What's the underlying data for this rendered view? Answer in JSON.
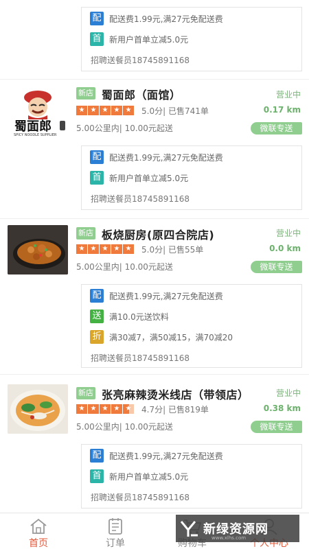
{
  "colors": {
    "accent_green": "#8fce8f",
    "badge_blue": "#2a7fd4",
    "badge_teal": "#2bb5a8",
    "badge_green": "#43b243",
    "badge_gold": "#d9a52b",
    "star_orange": "#f07a3c",
    "active_tab": "#e25a3b"
  },
  "top_box": {
    "promo1_badge": "配",
    "promo1_text": "配送费1.99元,满27元免配送费",
    "promo2_badge": "首",
    "promo2_text": "新用户首单立减5.0元",
    "recruit": "招聘送餐员18745891168"
  },
  "stores": [
    {
      "new_tag": "新店",
      "name": "蜀面郎（面馆）",
      "status": "营业中",
      "rating_text": "5.0分| 已售741单",
      "stars": 5,
      "distance": "0.17 km",
      "range": "5.00公里内| 10.00元起送",
      "delivery_tag": "微联专送",
      "logo_text": "蜀面郎",
      "logo_sub": "SPICY NOODLE SUPPLIER",
      "promos": [
        {
          "badge": "配",
          "text": "配送费1.99元,满27元免配送费"
        },
        {
          "badge": "首",
          "text": "新用户首单立减5.0元"
        }
      ],
      "recruit": "招聘送餐员18745891168"
    },
    {
      "new_tag": "新店",
      "name": "板烧厨房(原四合院店)",
      "status": "营业中",
      "rating_text": "5.0分| 已售55单",
      "stars": 5,
      "distance": "0.0 km",
      "range": "5.00公里内| 10.00元起送",
      "delivery_tag": "微联专送",
      "promos": [
        {
          "badge": "配",
          "text": "配送费1.99元,满27元免配送费"
        },
        {
          "badge": "送",
          "text": "满10.0元送饮料"
        },
        {
          "badge": "折",
          "text": "满30减7，满50减15，满70减20"
        }
      ],
      "recruit": "招聘送餐员18745891168"
    },
    {
      "new_tag": "新店",
      "name": "张亮麻辣烫米线店（带领店）",
      "status": "营业中",
      "rating_text": "4.7分| 已售819单",
      "stars": 4.7,
      "distance": "0.38 km",
      "range": "5.00公里内| 10.00元起送",
      "delivery_tag": "微联专送",
      "promos": [
        {
          "badge": "配",
          "text": "配送费1.99元,满27元免配送费"
        },
        {
          "badge": "首",
          "text": "新用户首单立减5.0元"
        }
      ],
      "recruit": "招聘送餐员18745891168"
    }
  ],
  "tabbar": {
    "home": "首页",
    "orders": "订单",
    "cart": "购物车",
    "profile": "个人中心"
  },
  "watermark": {
    "text": "新绿资源网",
    "sub": "www.xlhs.com"
  }
}
